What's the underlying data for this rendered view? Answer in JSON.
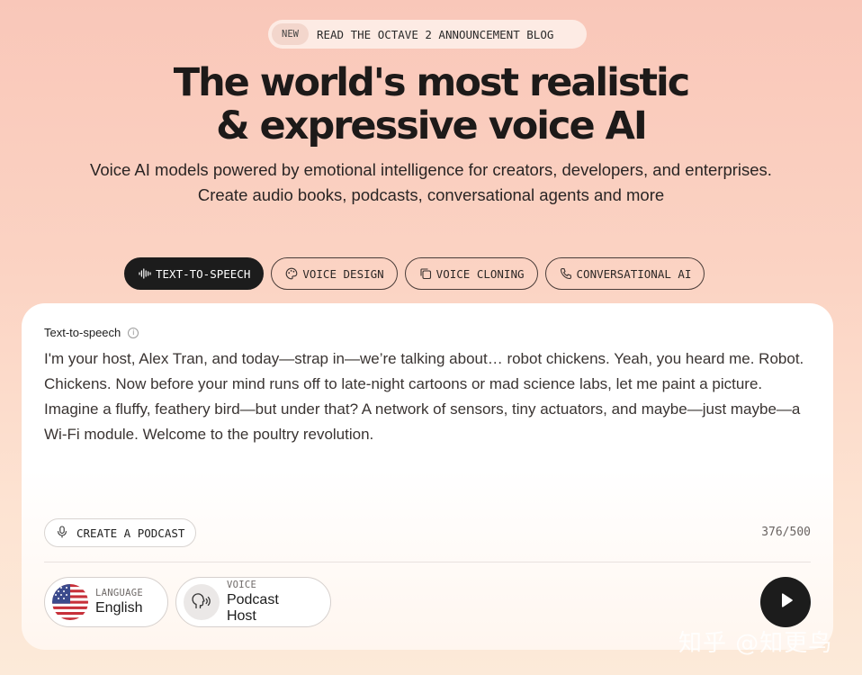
{
  "announcement": {
    "badge": "NEW",
    "text": "READ THE OCTAVE 2 ANNOUNCEMENT BLOG"
  },
  "hero": {
    "title_line1": "The world's most realistic",
    "title_line2": "& expressive voice AI",
    "subtitle": "Voice AI models powered by emotional intelligence for creators, developers, and enterprises. Create audio books, podcasts, conversational agents and more"
  },
  "tabs": [
    {
      "label": "TEXT-TO-SPEECH",
      "icon": "waveform-icon",
      "active": true
    },
    {
      "label": "VOICE DESIGN",
      "icon": "palette-icon",
      "active": false
    },
    {
      "label": "VOICE CLONING",
      "icon": "copy-icon",
      "active": false
    },
    {
      "label": "CONVERSATIONAL AI",
      "icon": "phone-icon",
      "active": false
    }
  ],
  "card": {
    "label": "Text-to-speech",
    "info_icon": "info-icon",
    "text": "I'm your host, Alex Tran, and today—strap in—we’re talking about… robot chickens. Yeah, you heard me. Robot. Chickens. Now before your mind runs off to late-night cartoons or mad science labs, let me paint a picture. Imagine a fluffy, feathery bird—but under that? A network of sensors, tiny actuators, and maybe—just maybe—a Wi-Fi module. Welcome to the poultry revolution.",
    "podcast_button": "CREATE A PODCAST",
    "counter": "376/500",
    "language": {
      "caption": "LANGUAGE",
      "value": "English",
      "icon": "us-flag-icon"
    },
    "voice": {
      "caption": "VOICE",
      "value": "Podcast Host",
      "icon": "speaking-head-icon"
    },
    "play_icon": "play-icon"
  },
  "watermark": "知乎 @知更鸟",
  "colors": {
    "accent_dark": "#1c1c1c",
    "background_top": "#f9c7b9",
    "background_bottom": "#fcead9"
  }
}
